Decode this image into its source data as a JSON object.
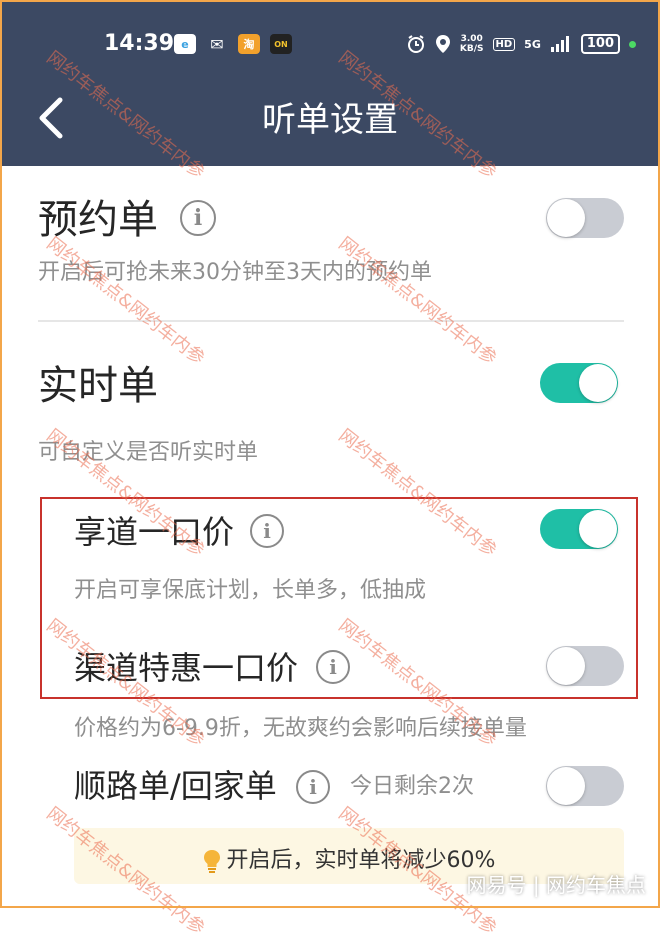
{
  "status_bar": {
    "time": "14:39",
    "net_speed_value": "3.00",
    "net_speed_unit": "KB/S",
    "hd_badge": "HD",
    "signal_label": "5G",
    "battery": "100"
  },
  "header": {
    "title": "听单设置"
  },
  "settings": {
    "reservation": {
      "label": "预约单",
      "desc": "开启后可抢未来30分钟至3天内的预约单",
      "enabled": false
    },
    "realtime": {
      "label": "实时单",
      "desc": "可自定义是否听实时单",
      "enabled": true
    },
    "fixed_price": {
      "label": "享道一口价",
      "desc": "开启可享保底计划，长单多，低抽成",
      "enabled": true
    },
    "channel_fixed_price": {
      "label": "渠道特惠一口价",
      "desc": "价格约为6-9.9折，无故爽约会影响后续接单量",
      "enabled": false
    },
    "route_home": {
      "label": "顺路单/回家单",
      "remaining": "今日剩余2次",
      "enabled": false
    }
  },
  "tip": {
    "text": "开启后，实时单将减少60%"
  },
  "watermark": {
    "text": "网约车焦点&网约车内参"
  },
  "corner_mark": {
    "text": "网易号 | 网约车焦点"
  },
  "colors": {
    "header_bg": "#3c4963",
    "toggle_on": "#1fbfa6",
    "toggle_off": "#c9ccd3",
    "highlight_box": "#c8322c"
  },
  "icons": [
    "back-arrow-icon",
    "info-icon",
    "lightbulb-icon",
    "alarm-icon",
    "location-icon",
    "wifi-icon",
    "signal-icon",
    "battery-icon"
  ]
}
